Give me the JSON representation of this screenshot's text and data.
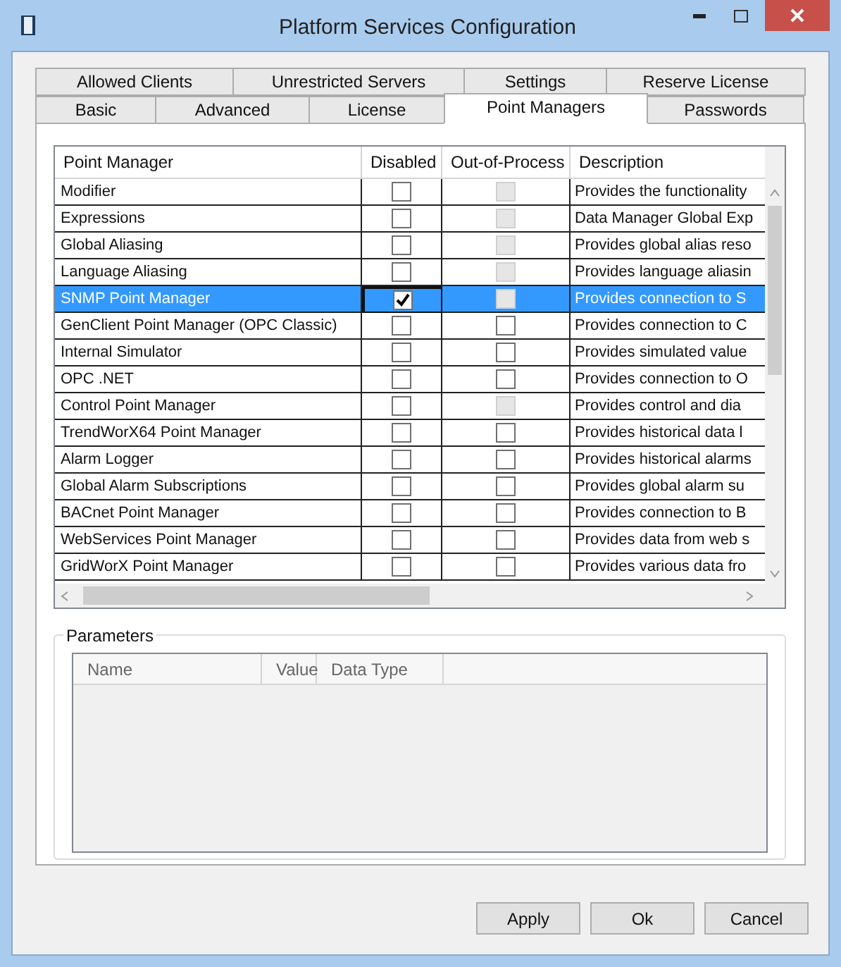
{
  "window": {
    "title": "Platform Services Configuration"
  },
  "tab_rows": [
    [
      {
        "label": "Allowed Clients",
        "selected": false
      },
      {
        "label": "Unrestricted Servers",
        "selected": false
      },
      {
        "label": "Settings",
        "selected": false
      },
      {
        "label": "Reserve License",
        "selected": false
      }
    ],
    [
      {
        "label": "Basic",
        "selected": false
      },
      {
        "label": "Advanced",
        "selected": false
      },
      {
        "label": "License",
        "selected": false
      },
      {
        "label": "Point Managers",
        "selected": true
      },
      {
        "label": "Passwords",
        "selected": false
      }
    ]
  ],
  "grid": {
    "columns": [
      "Point Manager",
      "Disabled",
      "Out-of-Process",
      "Description"
    ],
    "rows": [
      {
        "name": "Modifier",
        "disabled": false,
        "out_of_process": false,
        "out_of_process_enabled": false,
        "description": "Provides the functionality",
        "selected": false
      },
      {
        "name": "Expressions",
        "disabled": false,
        "out_of_process": false,
        "out_of_process_enabled": false,
        "description": "Data Manager Global Exp",
        "selected": false
      },
      {
        "name": "Global Aliasing",
        "disabled": false,
        "out_of_process": false,
        "out_of_process_enabled": false,
        "description": "Provides global alias reso",
        "selected": false
      },
      {
        "name": "Language Aliasing",
        "disabled": false,
        "out_of_process": false,
        "out_of_process_enabled": false,
        "description": "Provides language aliasin",
        "selected": false
      },
      {
        "name": "SNMP Point Manager",
        "disabled": true,
        "out_of_process": false,
        "out_of_process_enabled": false,
        "description": "Provides connection to S",
        "selected": true
      },
      {
        "name": "GenClient Point Manager (OPC Classic)",
        "disabled": false,
        "out_of_process": false,
        "out_of_process_enabled": true,
        "description": "Provides connection to C",
        "selected": false
      },
      {
        "name": "Internal Simulator",
        "disabled": false,
        "out_of_process": false,
        "out_of_process_enabled": true,
        "description": "Provides simulated value",
        "selected": false
      },
      {
        "name": "OPC .NET",
        "disabled": false,
        "out_of_process": false,
        "out_of_process_enabled": true,
        "description": "Provides connection to O",
        "selected": false
      },
      {
        "name": "Control Point Manager",
        "disabled": false,
        "out_of_process": false,
        "out_of_process_enabled": false,
        "description": "Provides control and dia",
        "selected": false
      },
      {
        "name": "TrendWorX64 Point Manager",
        "disabled": false,
        "out_of_process": false,
        "out_of_process_enabled": true,
        "description": "Provides historical data l",
        "selected": false
      },
      {
        "name": "Alarm Logger",
        "disabled": false,
        "out_of_process": false,
        "out_of_process_enabled": true,
        "description": "Provides historical alarms",
        "selected": false
      },
      {
        "name": "Global Alarm Subscriptions",
        "disabled": false,
        "out_of_process": false,
        "out_of_process_enabled": true,
        "description": "Provides global alarm su",
        "selected": false
      },
      {
        "name": "BACnet Point Manager",
        "disabled": false,
        "out_of_process": false,
        "out_of_process_enabled": true,
        "description": "Provides connection to B",
        "selected": false
      },
      {
        "name": "WebServices Point Manager",
        "disabled": false,
        "out_of_process": false,
        "out_of_process_enabled": true,
        "description": "Provides data from web s",
        "selected": false
      },
      {
        "name": "GridWorX Point Manager",
        "disabled": false,
        "out_of_process": false,
        "out_of_process_enabled": true,
        "description": "Provides various data fro",
        "selected": false
      }
    ]
  },
  "parameters": {
    "title": "Parameters",
    "columns": [
      "Name",
      "Value",
      "Data Type"
    ]
  },
  "buttons": [
    "Apply",
    "Ok",
    "Cancel"
  ]
}
